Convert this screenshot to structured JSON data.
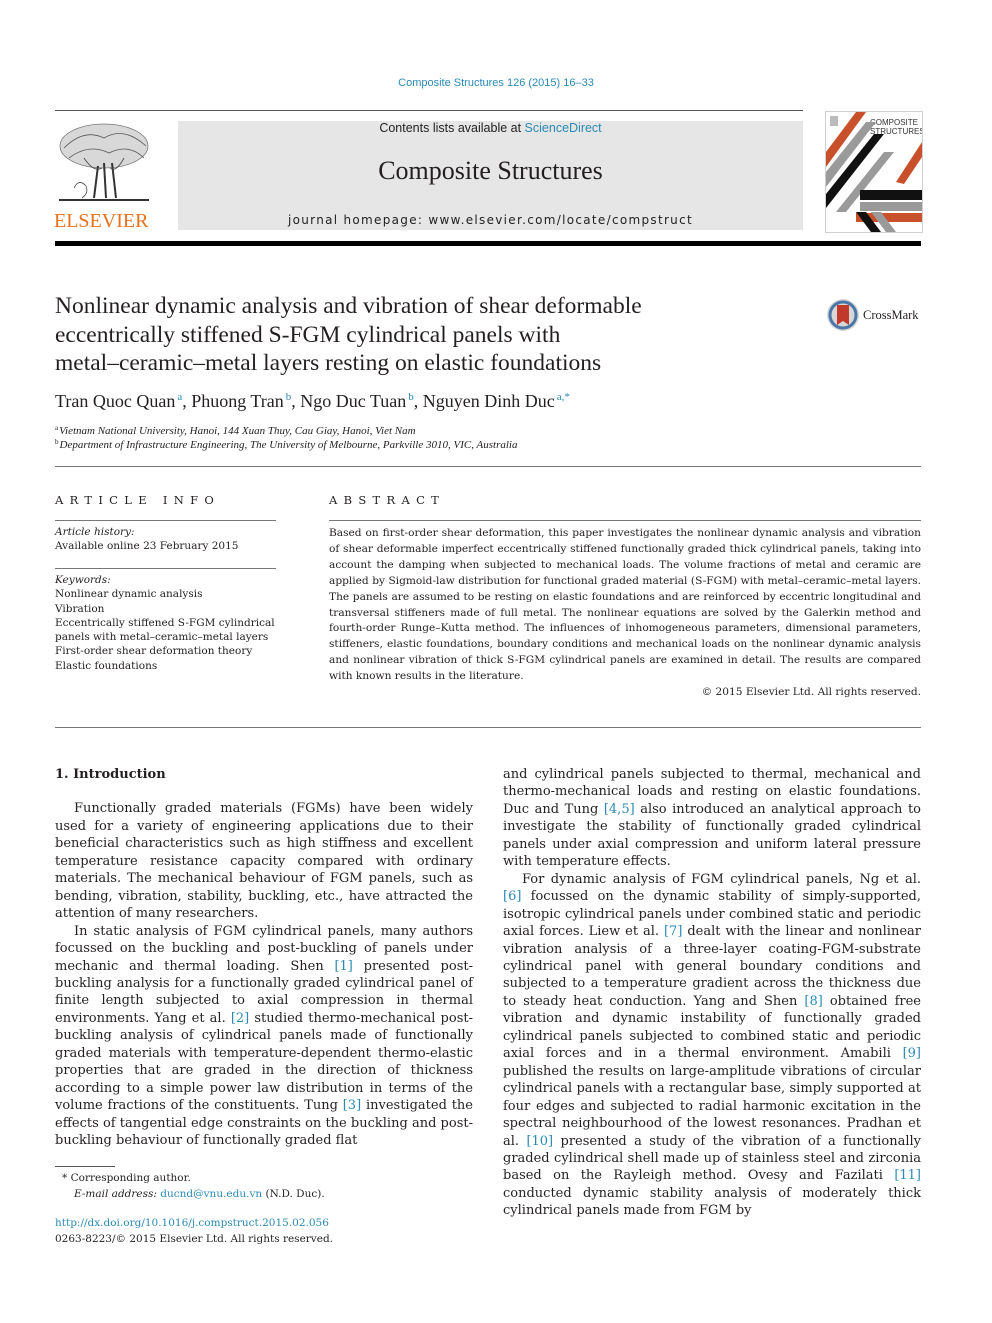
{
  "running_head": "Composite Structures 126 (2015) 16–33",
  "masthead": {
    "publisher_logo_text": "ELSEVIER",
    "contents_prefix": "Contents lists available at ",
    "contents_link": "ScienceDirect",
    "journal_title": "Composite Structures",
    "homepage_text": "journal homepage: www.elsevier.com/locate/compstruct",
    "cover_text_line1": "COMPOSITE",
    "cover_text_line2": "STRUCTURES",
    "colors": {
      "elsevier_orange": "#e9711c",
      "link_blue": "#2a8ab5",
      "cover_orange": "#c8502a",
      "masthead_gray": "#e6e6e6"
    }
  },
  "article": {
    "title_lines": [
      "Nonlinear dynamic analysis and vibration of shear deformable",
      "eccentrically stiffened S-FGM cylindrical panels with",
      "metal–ceramic–metal layers resting on elastic foundations"
    ],
    "crossmark_label": "CrossMark",
    "authors": [
      {
        "name": "Tran Quoc Quan",
        "sup": "a"
      },
      {
        "name": "Phuong Tran",
        "sup": "b"
      },
      {
        "name": "Ngo Duc Tuan",
        "sup": "b"
      },
      {
        "name": "Nguyen Dinh Duc",
        "sup": "a,*"
      }
    ],
    "affiliations": [
      {
        "sup": "a",
        "text": "Vietnam National University, Hanoi, 144 Xuan Thuy, Cau Giay, Hanoi, Viet Nam"
      },
      {
        "sup": "b",
        "text": "Department of Infrastructure Engineering, The University of Melbourne, Parkville 3010, VIC, Australia"
      }
    ]
  },
  "article_info": {
    "heading": "ARTICLE INFO",
    "history_label": "Article history:",
    "history_value": "Available online 23 February 2015",
    "keywords_label": "Keywords:",
    "keywords": [
      "Nonlinear dynamic analysis",
      "Vibration",
      "Eccentrically stiffened S-FGM cylindrical",
      "panels with metal–ceramic–metal layers",
      "First-order shear deformation theory",
      "Elastic foundations"
    ]
  },
  "abstract": {
    "heading": "ABSTRACT",
    "text": "Based on first-order shear deformation, this paper investigates the nonlinear dynamic analysis and vibration of shear deformable imperfect eccentrically stiffened functionally graded thick cylindrical panels, taking into account the damping when subjected to mechanical loads. The volume fractions of metal and ceramic are applied by Sigmoid-law distribution for functional graded material (S-FGM) with metal–ceramic–metal layers. The panels are assumed to be resting on elastic foundations and are reinforced by eccentric longitudinal and transversal stiffeners made of full metal. The nonlinear equations are solved by the Galerkin method and fourth-order Runge–Kutta method. The influences of inhomogeneous parameters, dimensional parameters, stiffeners, elastic foundations, boundary conditions and mechanical loads on the nonlinear dynamic analysis and nonlinear vibration of thick S-FGM cylindrical panels are examined in detail. The results are compared with known results in the literature.",
    "copyright": "© 2015 Elsevier Ltd. All rights reserved."
  },
  "body": {
    "section_heading": "1. Introduction",
    "left_paragraphs": [
      [
        {
          "t": "Functionally graded materials (FGMs) have been widely used for a variety of engineering applications due to their beneficial characteristics such as high stiffness and excellent temperature resistance capacity compared with ordinary materials. The mechanical behaviour of FGM panels, such as bending, vibration, stability, buckling, etc., have attracted the attention of many researchers."
        }
      ],
      [
        {
          "t": "In static analysis of FGM cylindrical panels, many authors focussed on the buckling and post-buckling of panels under mechanic and thermal loading. Shen "
        },
        {
          "ref": "[1]"
        },
        {
          "t": " presented post-buckling analysis for a functionally graded cylindrical panel of finite length subjected to axial compression in thermal environments. Yang et al. "
        },
        {
          "ref": "[2]"
        },
        {
          "t": " studied thermo-mechanical post-buckling analysis of cylindrical panels made of functionally graded materials with temperature-dependent thermo-elastic properties that are graded in the direction of thickness according to a simple power law distribution in terms of the volume fractions of the constituents. Tung "
        },
        {
          "ref": "[3]"
        },
        {
          "t": " investigated the effects of tangential edge constraints on the buckling and post-buckling behaviour of functionally graded flat"
        }
      ]
    ],
    "right_paragraphs": [
      [
        {
          "t": "and cylindrical panels subjected to thermal, mechanical and thermo-mechanical loads and resting on elastic foundations. Duc and Tung "
        },
        {
          "ref": "[4,5]"
        },
        {
          "t": " also introduced an analytical approach to investigate the stability of functionally graded cylindrical panels under axial compression and uniform lateral pressure with temperature effects."
        }
      ],
      [
        {
          "t": "For dynamic analysis of FGM cylindrical panels, Ng et al. "
        },
        {
          "ref": "[6]"
        },
        {
          "t": " focussed on the dynamic stability of simply-supported, isotropic cylindrical panels under combined static and periodic axial forces. Liew et al. "
        },
        {
          "ref": "[7]"
        },
        {
          "t": " dealt with the linear and nonlinear vibration analysis of a three-layer coating-FGM-substrate cylindrical panel with general boundary conditions and subjected to a temperature gradient across the thickness due to steady heat conduction. Yang and Shen "
        },
        {
          "ref": "[8]"
        },
        {
          "t": " obtained free vibration and dynamic instability of functionally graded cylindrical panels subjected to combined static and periodic axial forces and in a thermal environment. Amabili "
        },
        {
          "ref": "[9]"
        },
        {
          "t": " published the results on large-amplitude vibrations of circular cylindrical panels with a rectangular base, simply supported at four edges and subjected to radial harmonic excitation in the spectral neighbourhood of the lowest resonances. Pradhan et al. "
        },
        {
          "ref": "[10]"
        },
        {
          "t": " presented a study of the vibration of a functionally graded cylindrical shell made up of stainless steel and zirconia based on the Rayleigh method. Ovesy and Fazilati "
        },
        {
          "ref": "[11]"
        },
        {
          "t": " conducted dynamic stability analysis of moderately thick cylindrical panels made from FGM by"
        }
      ]
    ]
  },
  "footnotes": {
    "corresponding_mark": "*",
    "corresponding_text": "Corresponding author.",
    "email_label": "E-mail address: ",
    "email": "ducnd@vnu.edu.vn",
    "email_suffix": " (N.D. Duc).",
    "doi": "http://dx.doi.org/10.1016/j.compstruct.2015.02.056",
    "issn_line": "0263-8223/© 2015 Elsevier Ltd. All rights reserved."
  }
}
